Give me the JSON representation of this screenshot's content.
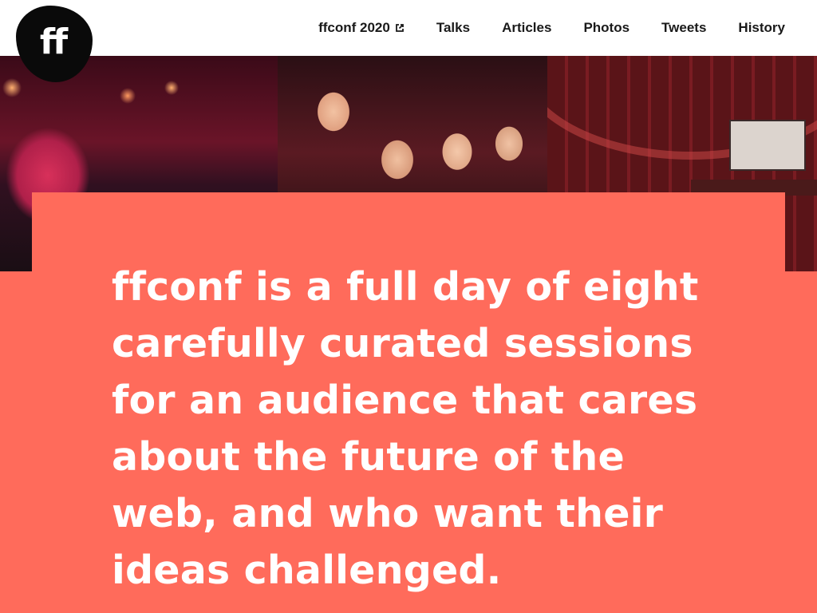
{
  "logo": {
    "text": "ff"
  },
  "nav": {
    "items": [
      {
        "label": "ffconf 2020",
        "external": true
      },
      {
        "label": "Talks"
      },
      {
        "label": "Articles"
      },
      {
        "label": "Photos"
      },
      {
        "label": "Tweets"
      },
      {
        "label": "History"
      }
    ]
  },
  "hero": {
    "headline": "ffconf is a full day of eight carefully curated sessions for an audience that cares about the future of the web, and who want their ideas challenged."
  },
  "colors": {
    "accent": "#ff6b5b",
    "header_bg": "#ffffff",
    "logo_bg": "#0a0a0a",
    "nav_text": "#1a1a1a"
  }
}
